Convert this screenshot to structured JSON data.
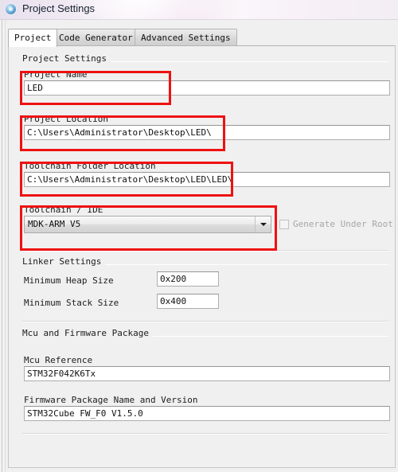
{
  "window": {
    "title": "Project Settings",
    "icon": "app-circle-icon"
  },
  "tabs": [
    {
      "label": "Project",
      "active": true
    },
    {
      "label": "Code Generator",
      "active": false
    },
    {
      "label": "Advanced Settings",
      "active": false
    }
  ],
  "groups": {
    "project_settings": {
      "label": "Project Settings",
      "fields": {
        "project_name": {
          "label": "Project Name",
          "value": "LED"
        },
        "project_location": {
          "label": "Project Location",
          "value": "C:\\Users\\Administrator\\Desktop\\LED\\"
        },
        "toolchain_folder_location": {
          "label": "Toolchain Folder Location",
          "value": "C:\\Users\\Administrator\\Desktop\\LED\\LED\\"
        },
        "toolchain_ide": {
          "label": "Toolchain / IDE",
          "value": "MDK-ARM V5",
          "dropdown_icon": "chevron-down-icon"
        },
        "generate_under_root": {
          "label": "Generate Under Root",
          "checked": false,
          "enabled": false
        }
      }
    },
    "linker_settings": {
      "label": "Linker Settings",
      "fields": {
        "min_heap": {
          "label": "Minimum Heap Size",
          "value": "0x200"
        },
        "min_stack": {
          "label": "Minimum Stack Size",
          "value": "0x400"
        }
      }
    },
    "mcu_firmware": {
      "label": "Mcu and Firmware Package",
      "fields": {
        "mcu_reference": {
          "label": "Mcu Reference",
          "value": "STM32F042K6Tx"
        },
        "firmware_package": {
          "label": "Firmware Package Name and Version",
          "value": "STM32Cube FW_F0 V1.5.0"
        }
      }
    }
  },
  "annotations": {
    "color": "#ee1111",
    "boxes": [
      {
        "name": "project-name-highlight"
      },
      {
        "name": "project-location-highlight"
      },
      {
        "name": "toolchain-folder-highlight"
      },
      {
        "name": "toolchain-ide-highlight"
      }
    ]
  }
}
